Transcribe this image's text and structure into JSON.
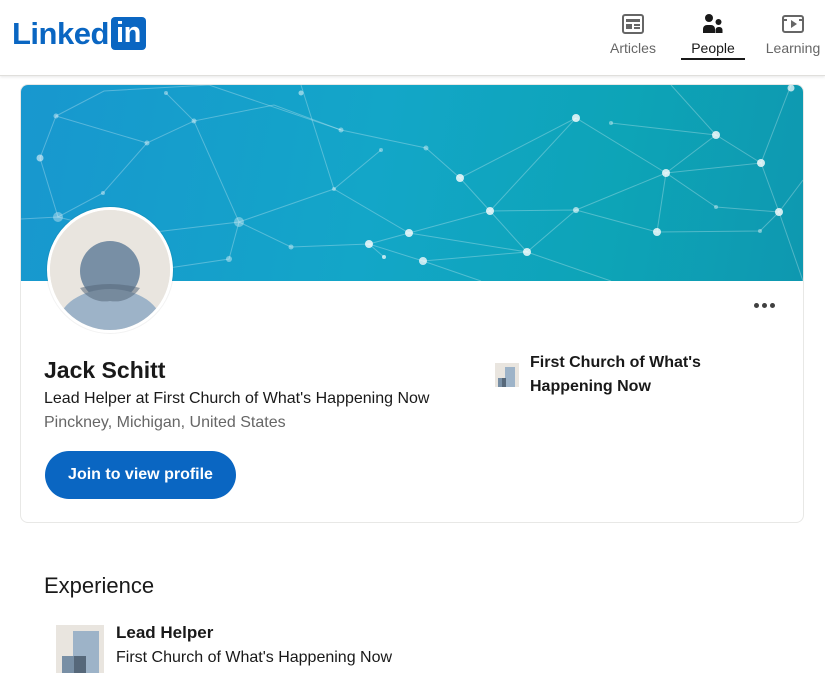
{
  "brand": {
    "logo_word": "Linked",
    "logo_box": "in",
    "color": "#0a66c2"
  },
  "nav": {
    "articles": {
      "label": "Articles",
      "icon": "articles-icon"
    },
    "people": {
      "label": "People",
      "icon": "people-icon",
      "active": true
    },
    "learning": {
      "label": "Learning",
      "icon": "learning-icon"
    }
  },
  "profile": {
    "name": "Jack Schitt",
    "headline": "Lead Helper at First Church of What's Happening Now",
    "location": "Pinckney, Michigan, United States",
    "join_label": "Join to view profile",
    "current_company": "First Church of What's Happening Now",
    "more_icon": "more-icon"
  },
  "experience": {
    "title": "Experience",
    "items": [
      {
        "role": "Lead Helper",
        "company": "First Church of What's Happening Now"
      }
    ]
  }
}
